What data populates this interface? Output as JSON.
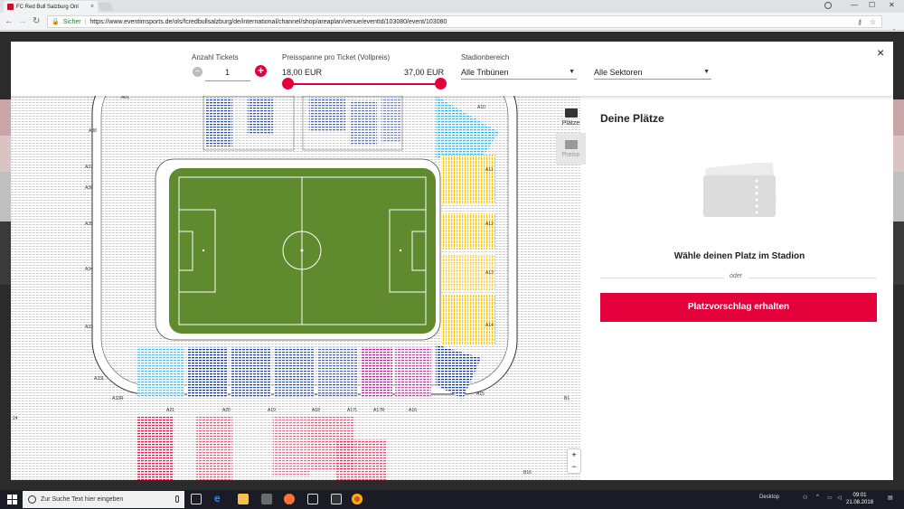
{
  "browser": {
    "tab_title": "FC Red Bull Salzburg Onl",
    "tab_close": "×",
    "secure_label": "Sicher",
    "url": "https://www.eventimsports.de/ols/fcredbullsalzburg/de/international/channel/shop/areaplan/venue/eventId/103080/event/103080"
  },
  "filters": {
    "tickets_label": "Anzahl Tickets",
    "tickets_value": "1",
    "minus": "−",
    "plus": "+",
    "price_label": "Preisspanne pro Ticket (Vollpreis)",
    "price_min": "18,00 EUR",
    "price_max": "37,00 EUR",
    "area_label": "Stadionbereich",
    "area_value": "Alle Tribünen",
    "sector_value": "Alle Sektoren",
    "close": "×"
  },
  "map": {
    "side_tabs": [
      {
        "label": "Plätze"
      },
      {
        "label": "Preise"
      }
    ],
    "zoom_in": "+",
    "zoom_out": "−",
    "block_labels": [
      "A01",
      "A10",
      "A38",
      "A37",
      "A36",
      "A35",
      "A34",
      "A33",
      "A33L",
      "A33R",
      "A21",
      "A20",
      "A19",
      "A18",
      "A17L",
      "A17R",
      "A16",
      "A15",
      "A14",
      "A13",
      "A12",
      "A11",
      "B16",
      "B1",
      "24"
    ],
    "colors": {
      "pitch": "#5f8a2e",
      "pitch_border": "#5f8a2e",
      "navy": "#1d3a8a",
      "cyan": "#3fb4e0",
      "yellow": "#f2c31b",
      "magenta": "#b02b8f",
      "red": "#d81e4a"
    }
  },
  "panel": {
    "title": "Deine Plätze",
    "message": "Wähle deinen Platz im Stadion",
    "or_label": "oder",
    "button": "Platzvorschlag erhalten"
  },
  "taskbar": {
    "search_placeholder": "Zur Suche Text hier eingeben",
    "desktop_label": "Desktop",
    "time": "09:01",
    "date": "21.08.2018"
  }
}
